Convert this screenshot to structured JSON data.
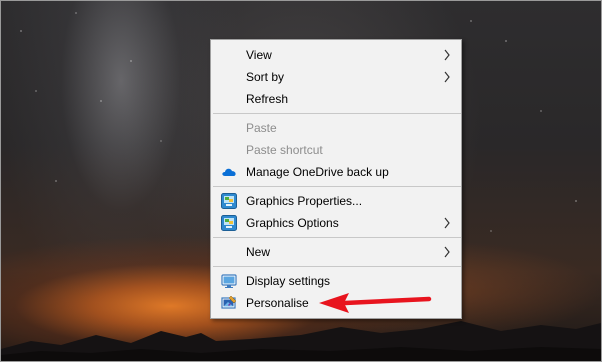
{
  "desktop": {
    "wallpaper": "night-sky-milky-way"
  },
  "context_menu": {
    "items": [
      {
        "label": "View",
        "submenu": true,
        "enabled": true
      },
      {
        "label": "Sort by",
        "submenu": true,
        "enabled": true
      },
      {
        "label": "Refresh",
        "submenu": false,
        "enabled": true
      },
      {
        "label": "Paste",
        "submenu": false,
        "enabled": false
      },
      {
        "label": "Paste shortcut",
        "submenu": false,
        "enabled": false
      },
      {
        "label": "Manage OneDrive back up",
        "icon": "onedrive-cloud-icon",
        "submenu": false,
        "enabled": true
      },
      {
        "label": "Graphics Properties...",
        "icon": "intel-graphics-icon",
        "submenu": false,
        "enabled": true
      },
      {
        "label": "Graphics Options",
        "icon": "intel-graphics-icon",
        "submenu": true,
        "enabled": true
      },
      {
        "label": "New",
        "submenu": true,
        "enabled": true
      },
      {
        "label": "Display settings",
        "icon": "monitor-icon",
        "submenu": false,
        "enabled": true
      },
      {
        "label": "Personalise",
        "icon": "personalise-icon",
        "submenu": false,
        "enabled": true
      }
    ]
  },
  "annotation": {
    "arrow_color": "#e8141e",
    "points_to": "Personalise"
  },
  "colors": {
    "menu_background": "#f2f2f2",
    "disabled_text": "#8d8d8d",
    "onedrive_blue": "#0a6fd6"
  }
}
